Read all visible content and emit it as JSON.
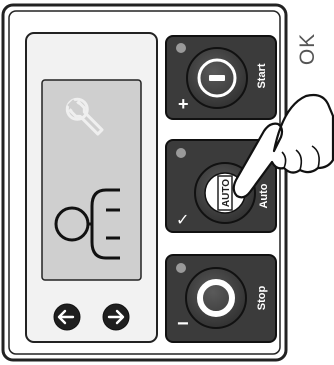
{
  "ok_label": "OK",
  "buttons": {
    "start": {
      "label": "Start",
      "side_symbol": "+"
    },
    "auto": {
      "label": "Auto",
      "badge": "AUTO",
      "side_symbol": "✓"
    },
    "stop": {
      "label": "Stop",
      "side_symbol": "−"
    }
  },
  "icons": {
    "display_wrench": "wrench-icon",
    "display_generator": "generator-icon",
    "nav_left": "arrow-left-icon",
    "nav_right": "arrow-right-icon",
    "start_symbol": "minus-in-circle-icon",
    "stop_symbol": "ring-icon",
    "pointer": "pointing-hand-icon"
  },
  "colors": {
    "panel_outline": "#222222",
    "display_fill": "#cfcfcf",
    "button_fill": "#3b3b3b",
    "button_face": "#4a4a4a",
    "indicator_led": "#9a9a9a"
  }
}
